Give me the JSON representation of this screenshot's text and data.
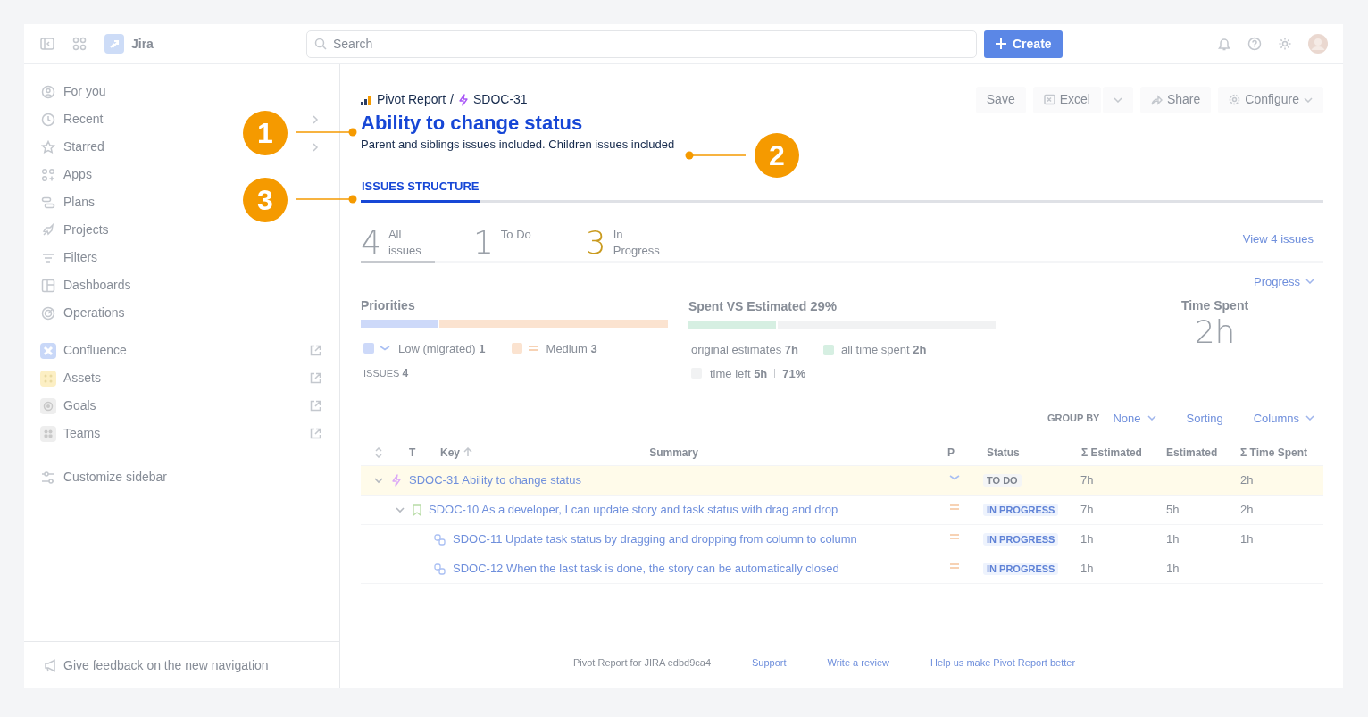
{
  "header": {
    "product": "Jira",
    "search_placeholder": "Search",
    "create_label": "Create"
  },
  "sidebar": {
    "items": [
      {
        "kind": "nav",
        "label": "For you",
        "expandable": false
      },
      {
        "kind": "nav",
        "label": "Recent",
        "expandable": true
      },
      {
        "kind": "nav",
        "label": "Starred",
        "expandable": true
      },
      {
        "kind": "nav",
        "label": "Apps",
        "expandable": false
      },
      {
        "kind": "nav",
        "label": "Plans",
        "expandable": false
      },
      {
        "kind": "nav",
        "label": "Projects",
        "expandable": false
      },
      {
        "kind": "nav",
        "label": "Filters",
        "expandable": false
      },
      {
        "kind": "nav",
        "label": "Dashboards",
        "expandable": false
      },
      {
        "kind": "nav",
        "label": "Operations",
        "expandable": false
      },
      {
        "kind": "app",
        "label": "Confluence",
        "color": "#c9d8f8"
      },
      {
        "kind": "app",
        "label": "Assets",
        "color": "#fcefc4"
      },
      {
        "kind": "app",
        "label": "Goals",
        "color": "#eeeeee"
      },
      {
        "kind": "app",
        "label": "Teams",
        "color": "#eeeeee"
      },
      {
        "kind": "settings",
        "label": "Customize sidebar"
      }
    ],
    "feedback": "Give feedback on the new navigation"
  },
  "breadcrumb": [
    {
      "kind": "report",
      "label": "Pivot Report"
    },
    {
      "kind": "epic",
      "label": "SDOC-31"
    }
  ],
  "breadcrumb_separator": "/",
  "actions": [
    {
      "kind": "text",
      "label": "Save"
    },
    {
      "kind": "excel",
      "label": "Excel"
    },
    {
      "kind": "caret"
    },
    {
      "kind": "share",
      "label": "Share"
    },
    {
      "kind": "configure",
      "label": "Configure"
    }
  ],
  "title": "Ability to change status",
  "subtitle": "Parent and siblings issues included. Children issues included",
  "tabs": [
    {
      "label": "ISSUES STRUCTURE",
      "selected": true
    }
  ],
  "stat_tabs": [
    {
      "count": "4",
      "label": "All issues",
      "selected": true,
      "color": "#9aa0a8"
    },
    {
      "count": "1",
      "label": "To Do",
      "selected": false,
      "color": "#9aa0a8"
    },
    {
      "count": "3",
      "label": "In Progress",
      "selected": false,
      "color": "#c99a1e"
    }
  ],
  "view_link": "View 4 issues",
  "priorities": {
    "title": "Priorities",
    "items": [
      {
        "kind": "low",
        "label": "Low (migrated)",
        "count": "1",
        "color": "#cdd9f9",
        "level": 0.25
      },
      {
        "kind": "medium",
        "label": "Medium",
        "count": "3",
        "color": "#fbe3d0",
        "level": 0.75
      }
    ],
    "total_label": "ISSUES",
    "total": "4"
  },
  "spent_vs_estimated": {
    "title": "Spent VS Estimated",
    "percent": "29%",
    "level": 0.29,
    "original_label": "original estimates",
    "original": "7h",
    "spent_label": "all time spent",
    "spent": "2h",
    "left_label": "time left",
    "left": "5h",
    "left_percent": "71%"
  },
  "progress_menu": "Progress",
  "time_spent": {
    "label": "Time Spent",
    "value": "2h"
  },
  "toolbar": {
    "group_by_label": "GROUP BY",
    "group_by": "None",
    "sorting": "Sorting",
    "columns": "Columns"
  },
  "table": {
    "columns": [
      "T",
      "Key",
      "Summary",
      "P",
      "Status",
      "Σ Estimated",
      "Estimated",
      "Σ Time Spent"
    ],
    "rows": [
      {
        "kind": "epic",
        "key": "SDOC-31",
        "summary": "Ability to change status",
        "priority": {
          "kind": "low"
        },
        "status": {
          "kind": "todo",
          "label": "TO DO"
        },
        "sum_estimated": "7h",
        "time_spent": "2h",
        "selected": true,
        "expanded": true,
        "children": [
          {
            "kind": "story",
            "key": "SDOC-10",
            "summary": "As a developer, I can update story and task status with drag and drop",
            "priority": {
              "kind": "medium"
            },
            "status": {
              "kind": "inprogress",
              "label": "IN PROGRESS"
            },
            "sum_estimated": "7h",
            "estimated": "5h",
            "time_spent": "2h",
            "selected": false,
            "expanded": true,
            "children": [
              {
                "kind": "subtask",
                "key": "SDOC-11",
                "summary": "Update task status by dragging and dropping from column to column",
                "priority": {
                  "kind": "medium"
                },
                "status": {
                  "kind": "inprogress",
                  "label": "IN PROGRESS"
                },
                "sum_estimated": "1h",
                "estimated": "1h",
                "time_spent": "1h",
                "selected": false
              },
              {
                "kind": "subtask",
                "key": "SDOC-12",
                "summary": "When the last task is done, the story can be automatically closed",
                "priority": {
                  "kind": "medium"
                },
                "status": {
                  "kind": "inprogress",
                  "label": "IN PROGRESS"
                },
                "sum_estimated": "1h",
                "estimated": "1h",
                "selected": false
              }
            ]
          }
        ]
      }
    ]
  },
  "footer": [
    {
      "kind": "text",
      "label": "Pivot Report for JIRA edbd9ca4"
    },
    {
      "kind": "link",
      "label": "Support"
    },
    {
      "kind": "link",
      "label": "Write a review"
    },
    {
      "kind": "link",
      "label": "Help us make Pivot Report better"
    }
  ],
  "callouts": [
    {
      "number": "1"
    },
    {
      "number": "2"
    },
    {
      "number": "3"
    }
  ]
}
